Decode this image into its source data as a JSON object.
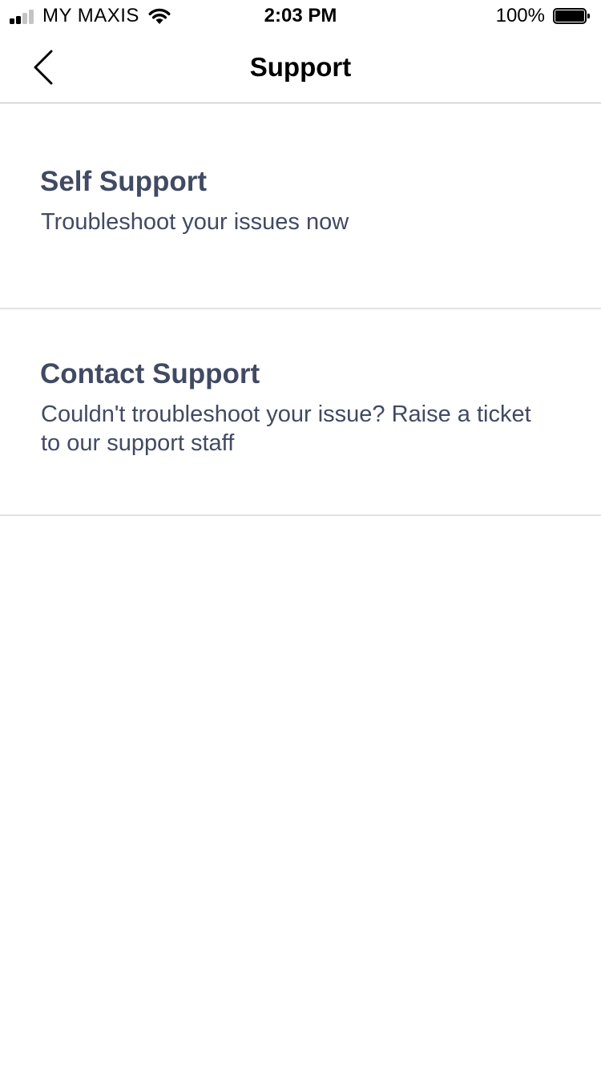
{
  "status_bar": {
    "carrier": "MY MAXIS",
    "time": "2:03 PM",
    "battery_percent": "100%",
    "signal_bars_filled": 2,
    "signal_bars_total": 4,
    "battery_level": 1.0
  },
  "nav": {
    "title": "Support",
    "back_icon": "chevron-left-icon"
  },
  "support_items": [
    {
      "title": "Self Support",
      "description": "Troubleshoot your issues now"
    },
    {
      "title": "Contact Support",
      "description": "Couldn't troubleshoot your issue? Raise a ticket to our support staff"
    }
  ],
  "colors": {
    "item_text": "#414a63",
    "divider": "#e2e2e2",
    "nav_border": "#bcbcbc",
    "signal_active": "#000000",
    "signal_inactive": "#c4c4c4"
  }
}
